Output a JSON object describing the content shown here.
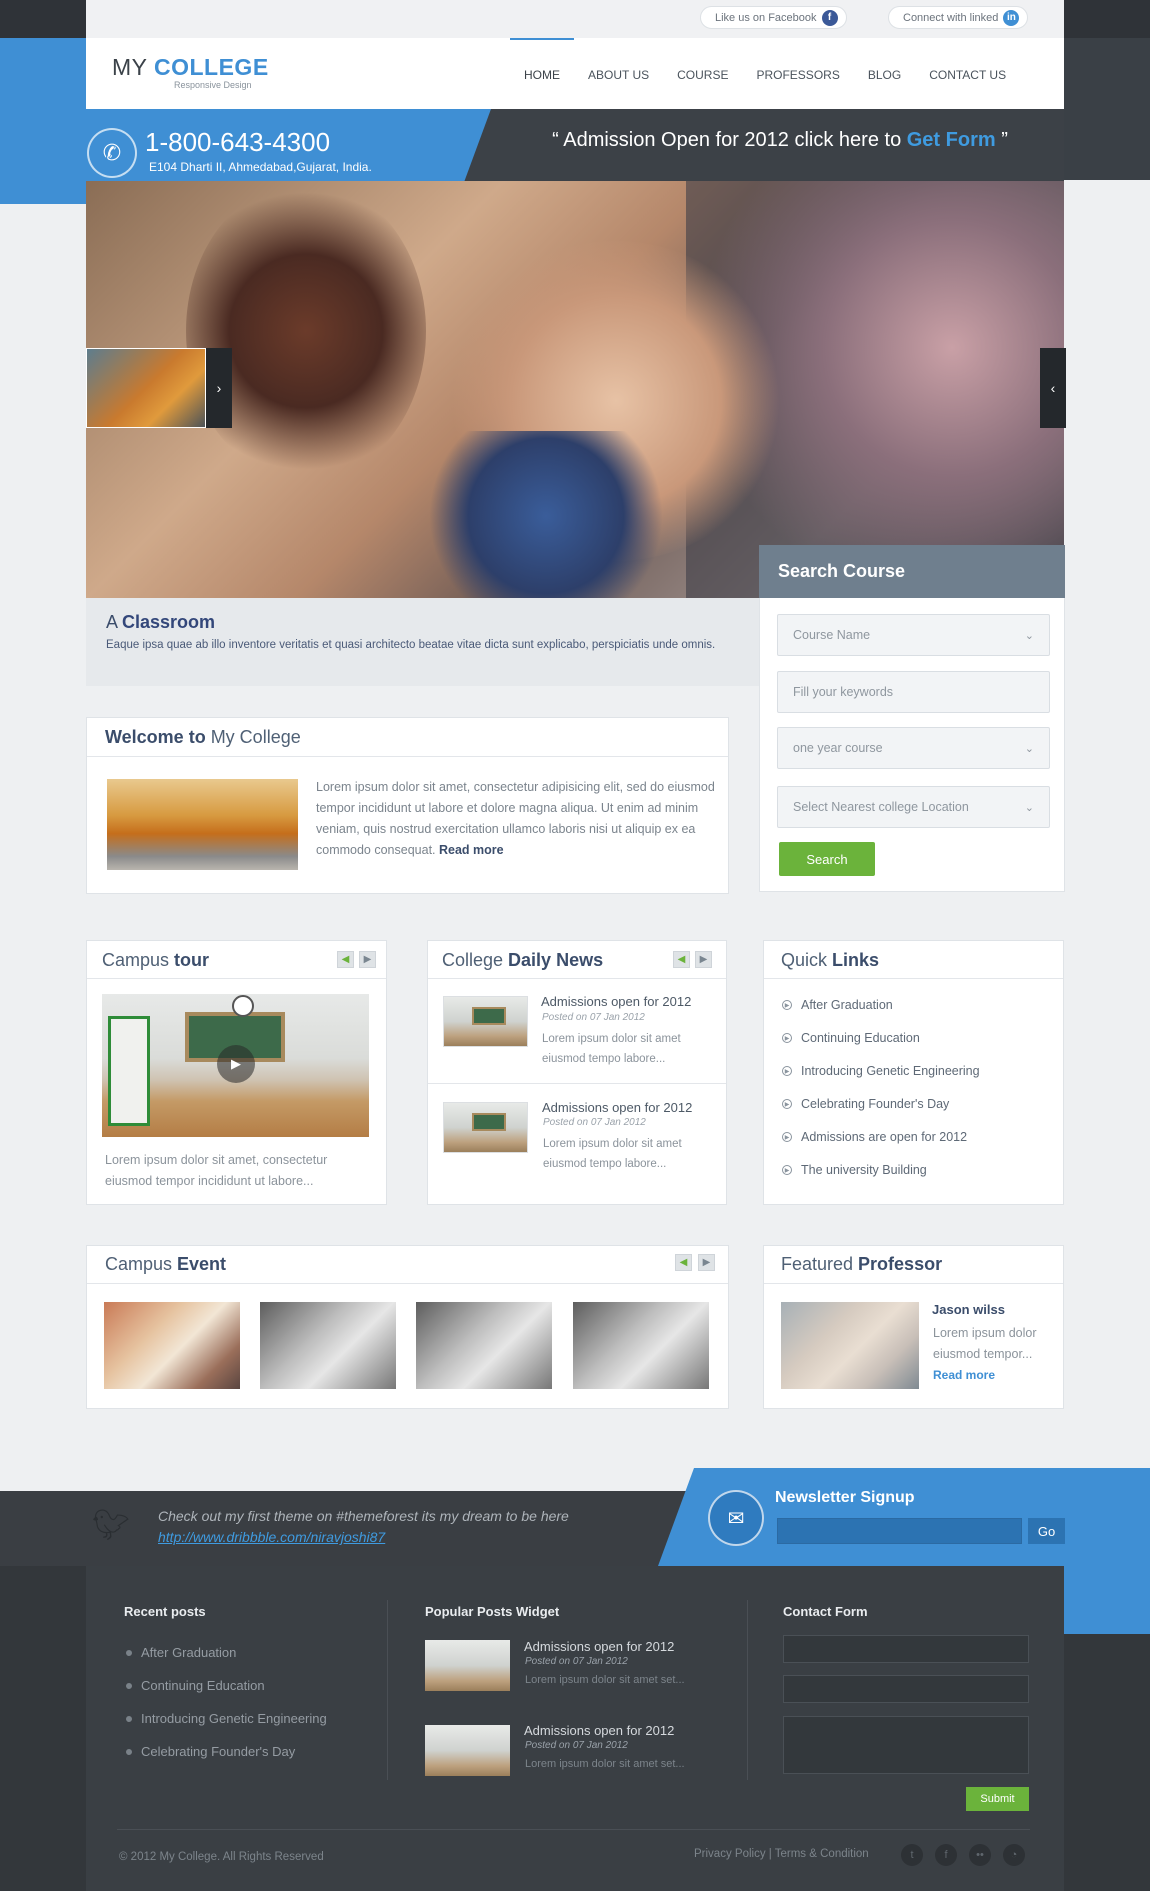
{
  "topbar": {
    "facebook_label": "Like us on  Facebook",
    "facebook_icon": "f",
    "linkedin_label": "Connect with linked",
    "linkedin_icon": "in"
  },
  "brand": {
    "logo_prefix": "MY ",
    "logo_strong": "COLLEGE",
    "tagline": "Responsive Design"
  },
  "nav": [
    "HOME",
    "ABOUT US",
    "COURSE",
    "PROFESSORS",
    "BLOG",
    "CONTACT US"
  ],
  "contact": {
    "phone": "1-800-643-4300",
    "address": "E104  Dharti II, Ahmedabad,Gujarat, India."
  },
  "admission": {
    "prefix": "“ Admission Open for 2012 click here to ",
    "link": "Get Form",
    "suffix": " ”"
  },
  "slider": {
    "caption_prefix": "A ",
    "caption_title": "Classroom",
    "caption_text": "Eaque ipsa quae ab illo inventore veritatis et quasi architecto beatae vitae dicta sunt explicabo, perspiciatis unde omnis.",
    "next_arrow": "›",
    "prev_arrow": "‹"
  },
  "search": {
    "title": "Search Course",
    "course_name": "Course Name",
    "keywords_placeholder": "Fill your keywords",
    "duration": "one year course",
    "location": "Select Nearest college Location",
    "button": "Search"
  },
  "welcome": {
    "title_prefix": "Welcome to",
    "title_rest": " My College",
    "text": "Lorem ipsum dolor sit amet, consectetur adipisicing elit, sed do eiusmod tempor incididunt ut labore et dolore magna aliqua. Ut enim ad minim veniam, quis nostrud exercitation ullamco laboris nisi ut aliquip ex ea commodo consequat.",
    "read_more": "Read more"
  },
  "campus_tour": {
    "title_prefix": "Campus ",
    "title_strong": "tour",
    "text": "Lorem ipsum dolor sit amet, consectetur eiusmod tempor incididunt ut labore..."
  },
  "news": {
    "title_prefix": "College ",
    "title_strong": "Daily News",
    "items": [
      {
        "title": "Admissions open for 2012",
        "posted": "Posted on 07 Jan 2012",
        "text": "Lorem ipsum dolor sit amet eiusmod tempo labore..."
      },
      {
        "title": "Admissions open for 2012",
        "posted": "Posted on 07 Jan 2012",
        "text": "Lorem ipsum dolor sit amet eiusmod tempo labore..."
      }
    ]
  },
  "quick_links": {
    "title_prefix": "Quick ",
    "title_strong": "Links",
    "items": [
      "After Graduation",
      "Continuing Education",
      "Introducing Genetic Engineering",
      "Celebrating Founder's Day",
      "Admissions are open for 2012",
      "The university Building"
    ]
  },
  "campus_event": {
    "title_prefix": "Campus ",
    "title_strong": "Event"
  },
  "professor": {
    "title_prefix": "Featured ",
    "title_strong": "Professor",
    "name": "Jason wilss",
    "text": "Lorem ipsum dolor eiusmod tempor...",
    "read_more": "Read more"
  },
  "twitter": {
    "text": "Check out my first theme on #themeforest its my dream to be here",
    "link": "http://www.dribbble.com/niravjoshi87"
  },
  "newsletter": {
    "title": "Newsletter Signup",
    "button": "Go"
  },
  "footer": {
    "recent_title": "Recent posts",
    "recent": [
      "After Graduation",
      "Continuing Education",
      "Introducing Genetic Engineering",
      "Celebrating Founder's Day"
    ],
    "popular_title": "Popular Posts Widget",
    "popular": [
      {
        "title": "Admissions open for 2012",
        "posted": "Posted on 07 Jan 2012",
        "text": "Lorem ipsum dolor sit amet set..."
      },
      {
        "title": "Admissions open for 2012",
        "posted": "Posted on 07 Jan 2012",
        "text": "Lorem ipsum dolor sit amet set..."
      }
    ],
    "contact_title": "Contact Form",
    "submit": "Submit",
    "copyright": "© 2012 My College. All Rights Reserved",
    "privacy": "Privacy Policy",
    "separator": " | ",
    "terms": "Terms & Condition",
    "social_icons": [
      "twitter-icon",
      "facebook-icon",
      "flickr-icon",
      "rss-icon"
    ]
  },
  "colors": {
    "accent": "#3f8fd4",
    "green": "#6bb33b",
    "dark": "#3a3f44"
  }
}
